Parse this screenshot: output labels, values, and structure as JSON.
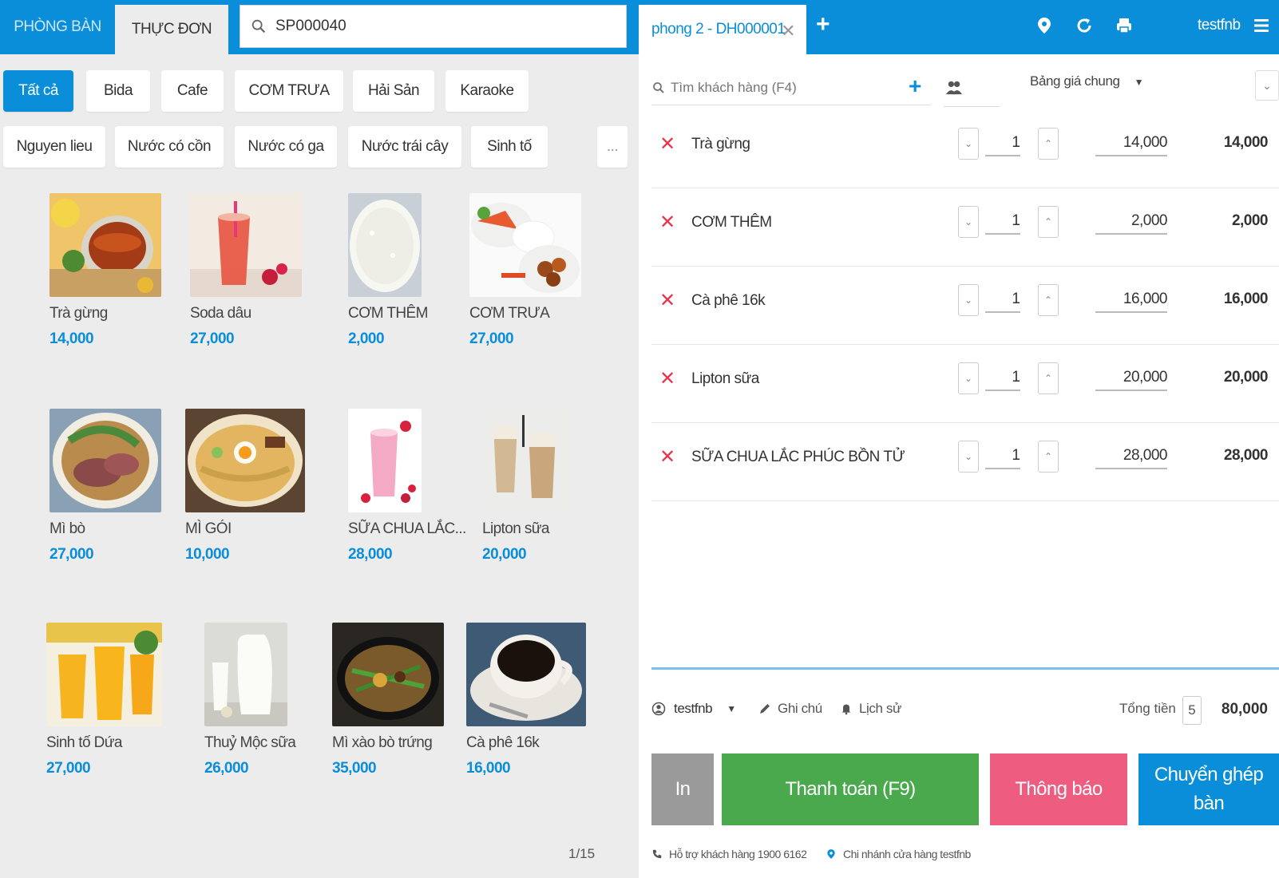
{
  "left": {
    "tabs": {
      "rooms": "PHÒNG BÀN",
      "menu": "THỰC ĐƠN"
    },
    "search": {
      "value": "SP000040"
    },
    "categories": [
      "Tất cả",
      "Bida",
      "Cafe",
      "CƠM TRƯA",
      "Hải Sản",
      "Karaoke",
      "Nguyen lieu",
      "Nước có cồn",
      "Nước có ga",
      "Nước trái cây",
      "Sinh tố",
      "..."
    ],
    "active_category": "Tất cả",
    "products": [
      {
        "name": "Trà gừng",
        "price": "14,000"
      },
      {
        "name": "Soda dâu",
        "price": "27,000"
      },
      {
        "name": "CƠM THÊM",
        "price": "2,000"
      },
      {
        "name": "CƠM TRƯA",
        "price": "27,000"
      },
      {
        "name": "Mì bò",
        "price": "27,000"
      },
      {
        "name": "MÌ GÓI",
        "price": "10,000"
      },
      {
        "name": "SỮA CHUA LẮC...",
        "price": "28,000"
      },
      {
        "name": "Lipton sữa",
        "price": "20,000"
      },
      {
        "name": "Sinh tố Dứa",
        "price": "27,000"
      },
      {
        "name": "Thuỷ Mộc sữa",
        "price": "26,000"
      },
      {
        "name": "Mì xào bò trứng",
        "price": "35,000"
      },
      {
        "name": "Cà phê 16k",
        "price": "16,000"
      }
    ],
    "pager": "1/15"
  },
  "right": {
    "order_tab": "phong 2 - DH000001",
    "add_tab": "+",
    "username": "testfnb",
    "customer_search_placeholder": "Tìm khách hàng (F4)",
    "price_book": "Bảng giá chung",
    "lines": [
      {
        "name": "Trà gừng",
        "qty": "1",
        "unit_price": "14,000",
        "total": "14,000"
      },
      {
        "name": "CƠM THÊM",
        "qty": "1",
        "unit_price": "2,000",
        "total": "2,000"
      },
      {
        "name": "Cà phê 16k",
        "qty": "1",
        "unit_price": "16,000",
        "total": "16,000"
      },
      {
        "name": "Lipton sữa",
        "qty": "1",
        "unit_price": "20,000",
        "total": "20,000"
      },
      {
        "name": "SỮA CHUA LẮC PHÚC BỒN TỬ",
        "qty": "1",
        "unit_price": "28,000",
        "total": "28,000"
      }
    ],
    "footer": {
      "seller": "testfnb",
      "note": "Ghi chú",
      "history": "Lịch sử",
      "total_label": "Tổng tiền",
      "total_count": "5",
      "total_amount": "80,000"
    },
    "actions": {
      "print": "In",
      "pay": "Thanh toán (F9)",
      "notify": "Thông báo",
      "transfer_line1": "Chuyển ghép",
      "transfer_line2": "bàn"
    },
    "support": "Hỗ trợ khách hàng 1900 6162",
    "branch": "Chi nhánh cửa hàng testfnb"
  },
  "colors": {
    "primary": "#0a8ed9",
    "pay": "#4aa94d",
    "notify": "#ee5c80",
    "print": "#9a9a9a",
    "delete": "#e8334a"
  }
}
